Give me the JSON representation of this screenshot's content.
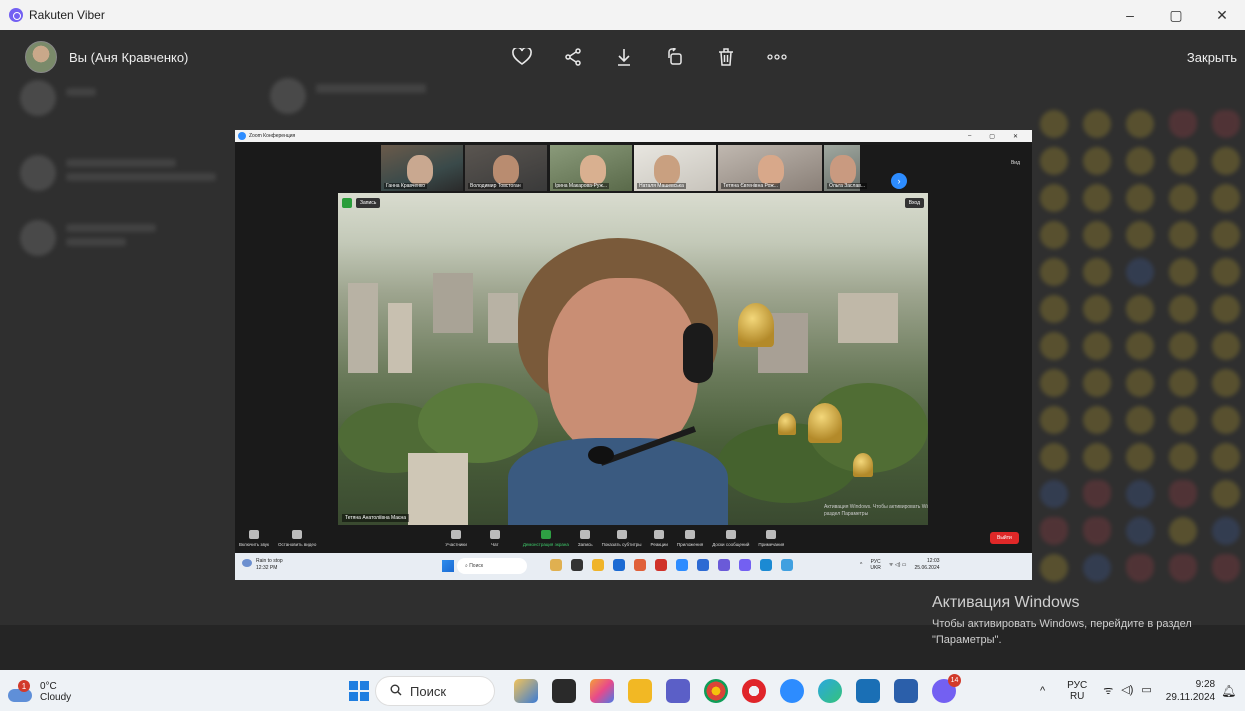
{
  "window": {
    "title": "Rakuten Viber",
    "controls": [
      "–",
      "▢",
      "✕"
    ]
  },
  "viewer": {
    "sender": "Вы (Аня Кравченко)",
    "actions": [
      "heart-icon",
      "share-icon",
      "download-icon",
      "rotate-icon",
      "trash-icon",
      "more-icon"
    ],
    "close_label": "Закрыть"
  },
  "zoom_image": {
    "title": "Zoom Конференция",
    "view_label": "Вид",
    "participants": [
      "Ганна Кравченко",
      "Володимир Товстоган",
      "Ірина Макарова-Руж...",
      "Наталя Машевська",
      "Тетяна Євгенівна Рож...",
      "Ольга Заслав..."
    ],
    "record_label": "Запись",
    "enter_label": "Вход",
    "speaker_name": "Тетяна Анатоліївна Маєна",
    "activation_overlay": "Активация Windows. Чтобы активировать Windows, перейдите в раздел Параметры",
    "controls": [
      "Включить звук",
      "Остановить видео",
      "Участники",
      "Чат",
      "Демонстрация экрана",
      "Запись",
      "Показать субтитры",
      "Реакции",
      "Приложения",
      "Доски сообщений",
      "Примечания"
    ],
    "participants_count": "11",
    "leave_label": "Выйти",
    "taskbar": {
      "weather_line1": "Rain to stop",
      "weather_line2": "12:32 PM",
      "search": "Поиск",
      "lang1": "РУС",
      "lang2": "UKR",
      "time": "12:03",
      "date": "25.06.2024"
    }
  },
  "activation": {
    "title": "Активация Windows",
    "text": "Чтобы активировать Windows, перейдите в раздел \"Параметры\"."
  },
  "taskbar": {
    "weather_badge": "1",
    "weather_temp": "0°C",
    "weather_desc": "Cloudy",
    "search_label": "Поиск",
    "viber_badge": "14",
    "lang_line1": "РУС",
    "lang_line2": "RU",
    "time": "9:28",
    "date": "29.11.2024"
  },
  "colors": {
    "viber_purple": "#7360f2",
    "zoom_blue": "#2d8cff",
    "zoom_leave_red": "#e02828",
    "windows_blue": "#1f7ee0"
  }
}
